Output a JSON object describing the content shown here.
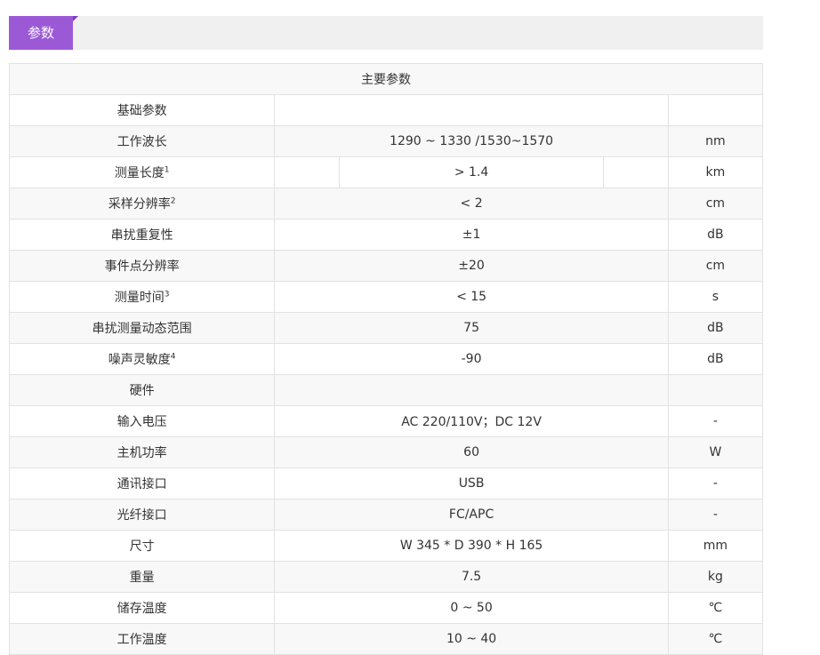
{
  "tab": {
    "label": "参数"
  },
  "table": {
    "header": "主要参数",
    "rows": [
      {
        "label": "基础参数",
        "value": "",
        "unit": ""
      },
      {
        "label": "工作波长",
        "value": "1290 ~ 1330 /1530~1570",
        "unit": "nm"
      },
      {
        "label": "测量长度",
        "sup": "1",
        "value": "> 1.4",
        "unit": "km"
      },
      {
        "label": "采样分辨率",
        "sup": "2",
        "value": "< 2",
        "unit": "cm"
      },
      {
        "label": "串扰重复性",
        "value": "±1",
        "unit": "dB"
      },
      {
        "label": "事件点分辨率",
        "value": "±20",
        "unit": "cm"
      },
      {
        "label": "测量时间",
        "sup": "3",
        "value": "< 15",
        "unit": "s"
      },
      {
        "label": "串扰测量动态范围",
        "value": "75",
        "unit": "dB"
      },
      {
        "label": "噪声灵敏度",
        "sup": "4",
        "value": "-90",
        "unit": "dB"
      },
      {
        "label": "硬件",
        "value": "",
        "unit": ""
      },
      {
        "label": "输入电压",
        "value": "AC 220/110V；DC 12V",
        "unit": "-"
      },
      {
        "label": "主机功率",
        "value": "60",
        "unit": "W"
      },
      {
        "label": "通讯接口",
        "value": "USB",
        "unit": "-"
      },
      {
        "label": "光纤接口",
        "value": "FC/APC",
        "unit": "-"
      },
      {
        "label": "尺寸",
        "value": "W 345 * D 390 * H 165",
        "unit": "mm"
      },
      {
        "label": "重量",
        "value": "7.5",
        "unit": "kg"
      },
      {
        "label": "储存温度",
        "value": "0 ~ 50",
        "unit": "℃"
      },
      {
        "label": "工作温度",
        "value": "10 ~ 40",
        "unit": "℃"
      }
    ]
  }
}
